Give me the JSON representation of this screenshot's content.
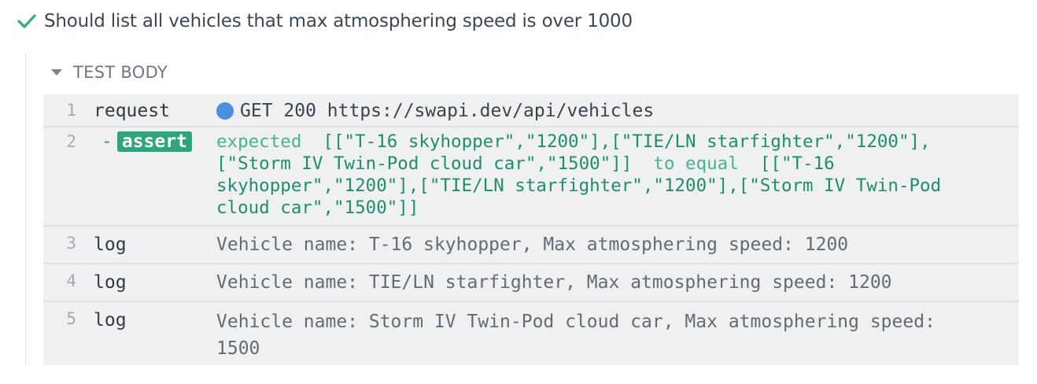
{
  "test": {
    "title": "Should list all vehicles that max atmosphering speed is over 1000",
    "status_icon": "check-icon",
    "status_color": "#3cae83"
  },
  "section": {
    "label": "TEST BODY",
    "toggle_icon": "caret-down-icon"
  },
  "commands": [
    {
      "number": "1",
      "name": "request",
      "message": "GET 200 https://swapi.dev/api/vehicles",
      "indicator_color": "#4b8fde"
    },
    {
      "number": "2",
      "prefix": "-",
      "name": "assert",
      "expected_word": "expected",
      "expected_value": "[[\"T-16 skyhopper\",\"1200\"],[\"TIE/LN starfighter\",\"1200\"],[\"Storm IV Twin-Pod cloud car\",\"1500\"]]",
      "to_equal_word": "to equal",
      "actual_value": "[[\"T-16 skyhopper\",\"1200\"],[\"TIE/LN starfighter\",\"1200\"],[\"Storm IV Twin-Pod cloud car\",\"1500\"]]"
    },
    {
      "number": "3",
      "name": "log",
      "message": "Vehicle name: T-16 skyhopper, Max atmosphering speed: 1200"
    },
    {
      "number": "4",
      "name": "log",
      "message": "Vehicle name: TIE/LN starfighter, Max atmosphering speed: 1200"
    },
    {
      "number": "5",
      "name": "log",
      "message": "Vehicle name: Storm IV Twin-Pod cloud car, Max atmosphering speed: 1500"
    }
  ]
}
